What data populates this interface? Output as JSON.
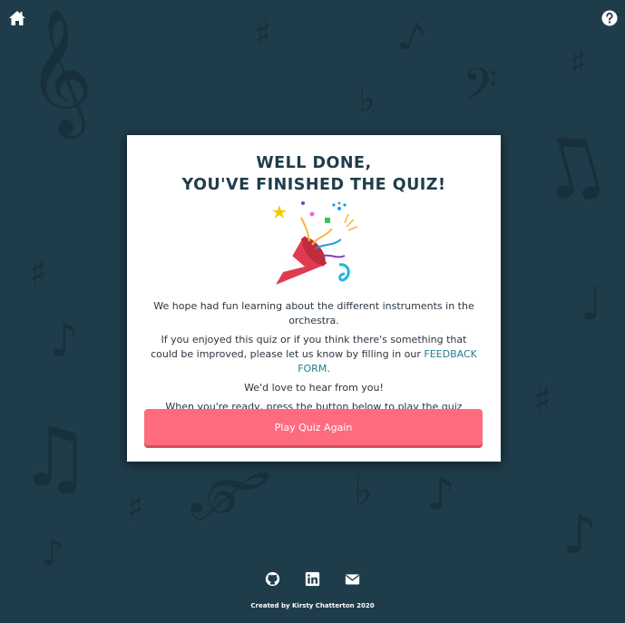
{
  "nav": {
    "home_icon": "home-icon",
    "help_icon": "help-icon"
  },
  "modal": {
    "title_line1": "WELL DONE,",
    "title_line2": "YOU'VE FINISHED THE QUIZ!",
    "illustration": "party-popper-icon",
    "para1": "We hope had fun learning about the different instruments in the orchestra.",
    "para2_before": "If you enjoyed this quiz or if you think there's something that could be improved, please let us know by filling in our",
    "para2_link": "FEEDBACK FORM",
    "para2_after": ".",
    "para3": "We'd love to hear from you!",
    "para4": "When you're ready, press the button below to play the quiz again.",
    "button_label": "Play Quiz Again"
  },
  "footer": {
    "icons": [
      "github-icon",
      "linkedin-icon",
      "envelope-icon"
    ],
    "credit": "Created by Kirsty Chatterton 2020"
  },
  "colors": {
    "background": "#1f3c4a",
    "note_shade": "#17303b",
    "button": "#fe6b7e",
    "link": "#1f7e93"
  }
}
